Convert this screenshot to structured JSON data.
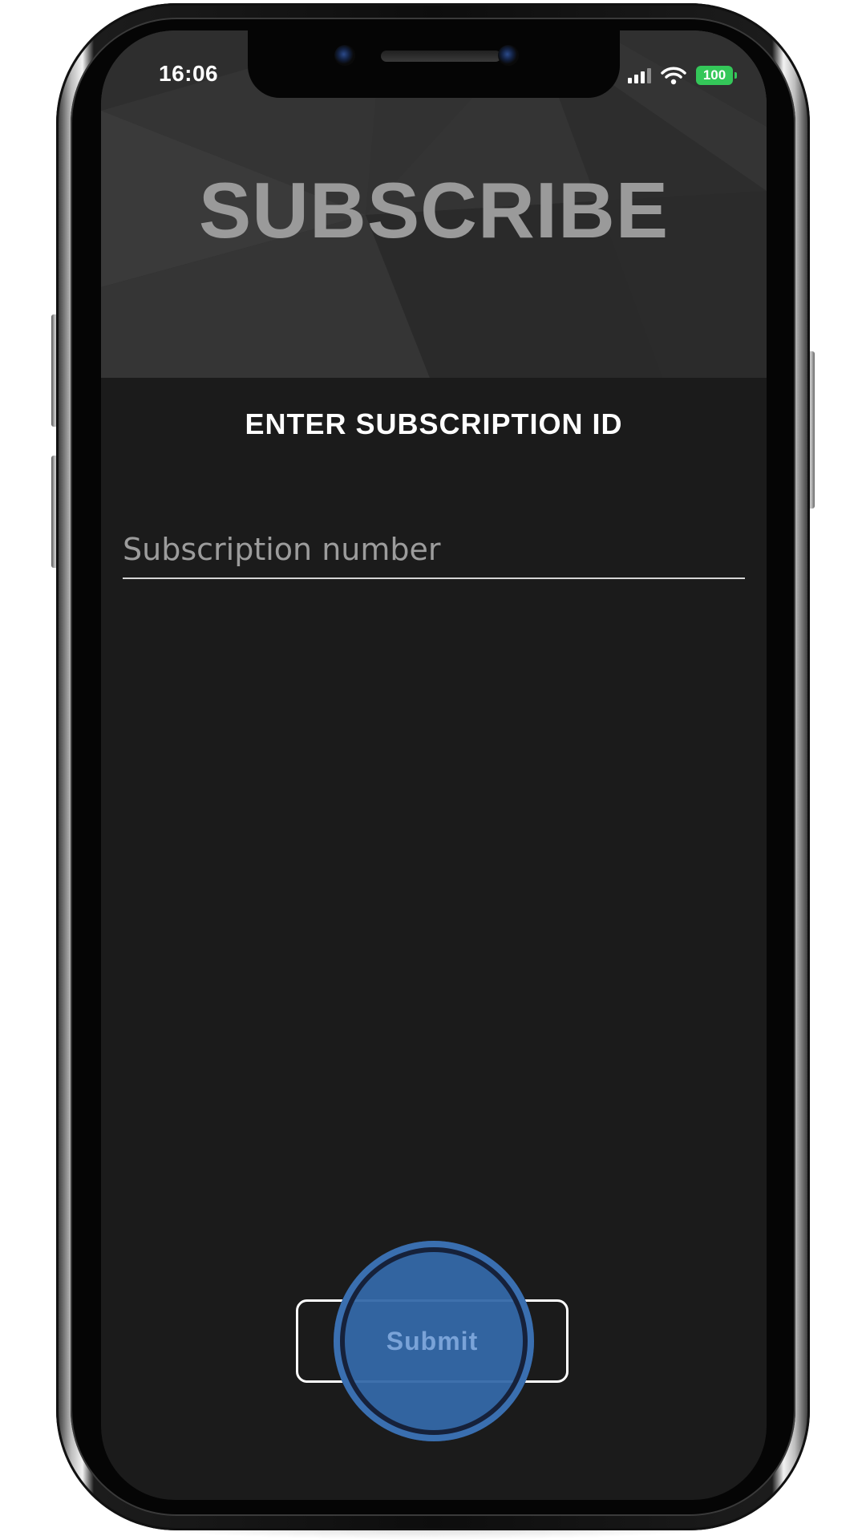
{
  "status_bar": {
    "time": "16:06",
    "battery_level": "100",
    "signal_icon": "cellular-signal-icon",
    "wifi_icon": "wifi-icon"
  },
  "header": {
    "title": "SUBSCRIBE"
  },
  "form": {
    "heading": "ENTER SUBSCRIPTION ID",
    "subscription_input": {
      "value": "",
      "placeholder": "Subscription number"
    },
    "submit_label": "Submit"
  },
  "colors": {
    "background": "#1b1b1b",
    "header_background": "#2d2d2d",
    "title_text": "#9a9a9a",
    "tap_indicator": "#3468a8",
    "battery": "#34c759"
  }
}
